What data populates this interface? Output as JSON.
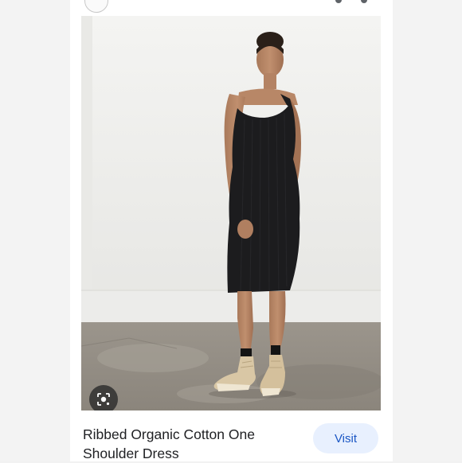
{
  "result": {
    "title": "Ribbed Organic Cotton One Shoulder Dress",
    "visit_label": "Visit"
  },
  "photo": {
    "alt": "Model wearing black one shoulder midi dress with beige boots"
  },
  "icons": {
    "lens": "image-search-icon"
  },
  "colors": {
    "visit_bg": "#e8f0fe",
    "visit_text": "#1a56c4",
    "lens_bg": "#282828"
  }
}
